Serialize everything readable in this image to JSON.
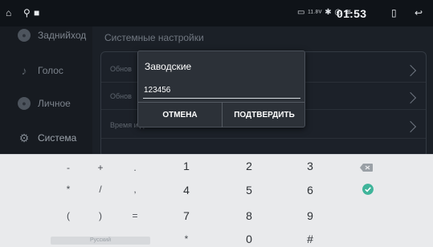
{
  "status_bar": {
    "home_icon": "home-icon",
    "usb_icon": "usb-icon",
    "media_icon": "square-icon",
    "signal_text": "11.8V",
    "time": "01:53",
    "back_icon": "back-icon"
  },
  "sidebar": {
    "items": [
      {
        "label": "Заднийход",
        "icon": "camera-icon"
      },
      {
        "label": "Голос",
        "icon": "microphone-icon"
      },
      {
        "label": "Личное",
        "icon": "person-icon"
      },
      {
        "label": "Система",
        "icon": "settings-icon"
      }
    ]
  },
  "main": {
    "title": "Системные настройки",
    "rows": [
      {
        "label": "Обнов"
      },
      {
        "label": "Обнов"
      },
      {
        "label": "Время и дата"
      }
    ]
  },
  "dialog": {
    "title": "Заводские",
    "input_value": "123456",
    "cancel_label": "ОТМЕНА",
    "confirm_label": "ПОДТВЕРДИТЬ"
  },
  "keyboard": {
    "rows": [
      [
        "-",
        "+",
        ".",
        "1",
        "2",
        "3"
      ],
      [
        "*",
        "/",
        ",",
        "4",
        "5",
        "6"
      ],
      [
        "(",
        ")",
        "=",
        "7",
        "8",
        "9"
      ],
      [
        "*",
        "0",
        "#"
      ]
    ],
    "space_label": "Русский",
    "accent_color": "#3fb49a"
  }
}
